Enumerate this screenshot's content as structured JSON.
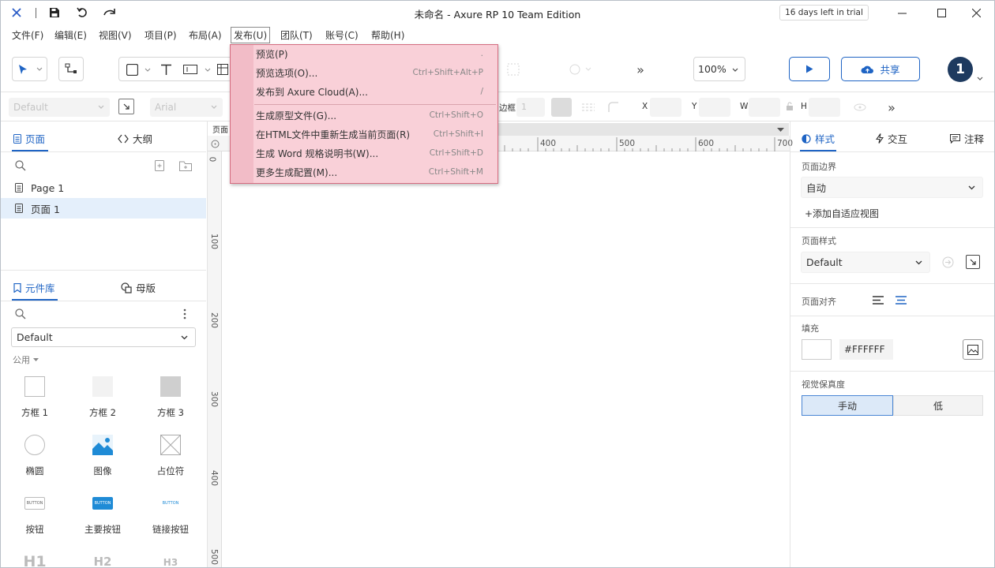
{
  "window": {
    "title": "未命名 - Axure RP 10 Team Edition",
    "trial": "16 days left in trial"
  },
  "menubar": [
    {
      "label": "文件(F)"
    },
    {
      "label": "编辑(E)"
    },
    {
      "label": "视图(V)"
    },
    {
      "label": "项目(P)"
    },
    {
      "label": "布局(A)"
    },
    {
      "label": "发布(U)"
    },
    {
      "label": "团队(T)"
    },
    {
      "label": "账号(C)"
    },
    {
      "label": "帮助(H)"
    }
  ],
  "publish_menu": {
    "items": [
      {
        "label": "预览(P)",
        "shortcut": "."
      },
      {
        "label": "预览选项(O)...",
        "shortcut": "Ctrl+Shift+Alt+P"
      },
      {
        "label": "发布到 Axure Cloud(A)...",
        "shortcut": "/"
      },
      {
        "label": "生成原型文件(G)...",
        "shortcut": "Ctrl+Shift+O"
      },
      {
        "label": "在HTML文件中重新生成当前页面(R)",
        "shortcut": "Ctrl+Shift+I"
      },
      {
        "label": "生成 Word 规格说明书(W)...",
        "shortcut": "Ctrl+Shift+D"
      },
      {
        "label": "更多生成配置(M)...",
        "shortcut": "Ctrl+Shift+M"
      }
    ]
  },
  "toolbar": {
    "zoom": "100%",
    "share_label": "共享",
    "user_count": "1",
    "more": "»"
  },
  "stylebar": {
    "style_default": "Default",
    "font": "Arial",
    "border_label": "边框",
    "border_value": "1",
    "x_label": "X",
    "y_label": "Y",
    "w_label": "W",
    "h_label": "H"
  },
  "left_panel": {
    "pages_tab": "页面",
    "outline_tab": "大纲",
    "pages": [
      {
        "label": "Page 1"
      },
      {
        "label": "页面 1"
      }
    ],
    "library_tab": "元件库",
    "masters_tab": "母版",
    "library_select": "Default",
    "library_group": "公用",
    "widgets": [
      {
        "label": "方框 1"
      },
      {
        "label": "方框 2"
      },
      {
        "label": "方框 3"
      },
      {
        "label": "椭圆"
      },
      {
        "label": "图像"
      },
      {
        "label": "占位符"
      },
      {
        "label": "按钮"
      },
      {
        "label": "主要按钮"
      },
      {
        "label": "链接按钮"
      },
      {
        "label": "H1"
      },
      {
        "label": "H2"
      },
      {
        "label": "H3"
      }
    ],
    "button_thumb": "BUTTON"
  },
  "canvas": {
    "tab_label": "页面",
    "ruler_top": [
      "400",
      "500",
      "600",
      "700"
    ],
    "ruler_left": [
      "0",
      "100",
      "200",
      "300",
      "400",
      "500"
    ]
  },
  "right_panel": {
    "style_tab": "样式",
    "interact_tab": "交互",
    "notes_tab": "注释",
    "page_border_label": "页面边界",
    "page_border_value": "自动",
    "add_adaptive": "+添加自适应视图",
    "page_style_label": "页面样式",
    "page_style_value": "Default",
    "page_align_label": "页面对齐",
    "fill_label": "填充",
    "fill_value": "#FFFFFF",
    "fidelity_label": "视觉保真度",
    "fidelity_manual": "手动",
    "fidelity_low": "低"
  },
  "colors": {
    "accent": "#1f64c4",
    "dropdown_bg": "#f9d0d8",
    "dropdown_border": "#d46c80",
    "user_badge": "#1e3a5f"
  }
}
